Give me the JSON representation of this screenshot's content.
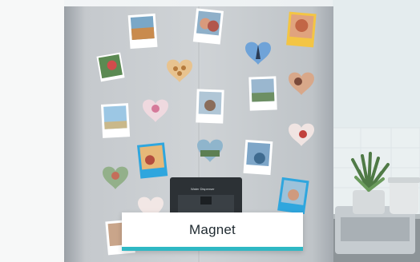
{
  "scene": {
    "description_icon": "photo-magnets-on-fridge-icon",
    "caption": "Magnet",
    "dispenser_label": "Water Dispenser",
    "colors": {
      "wall": "#eef1f2",
      "fridge": "#b9bec3",
      "tile": "#e6eef0",
      "accent": "#2fb8c4",
      "caption_text": "#1f2a30"
    }
  }
}
